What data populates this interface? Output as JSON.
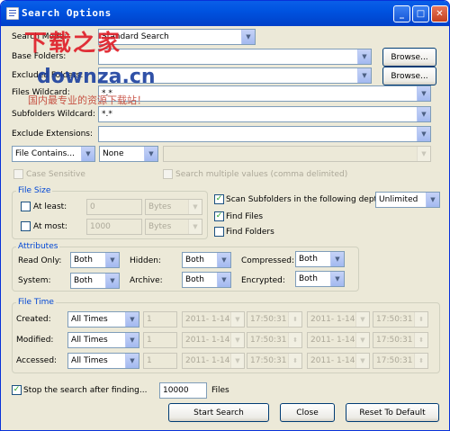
{
  "window": {
    "title": "Search Options",
    "buttons": [
      "_",
      "□",
      "✕"
    ]
  },
  "watermark": {
    "logo": "下载之家",
    "url": "downza.cn",
    "slogan": "国内最专业的资源下载站！"
  },
  "main": {
    "search_mode_label": "Search Mode:",
    "search_mode_value": "Standard Search",
    "base_folders_label": "Base Folders:",
    "base_folders_value": "",
    "browse1": "Browse...",
    "excluded_folders_label": "Excluded Folders:",
    "excluded_folders_value": "",
    "browse2": "Browse...",
    "files_wildcard_label": "Files Wildcard:",
    "files_wildcard_value": "*.*",
    "subfolders_wildcard_label": "Subfolders Wildcard:",
    "subfolders_wildcard_value": "*.*",
    "exclude_extensions_label": "Exclude Extensions:",
    "exclude_extensions_value": ""
  },
  "contains": {
    "mode": "File Contains...",
    "type": "None",
    "text": "",
    "case_sensitive": "Case Sensitive",
    "multiple_values": "Search multiple values (comma delimited)"
  },
  "file_size": {
    "title": "File Size",
    "at_least_label": "At least:",
    "at_least_value": "0",
    "at_least_unit": "Bytes",
    "at_most_label": "At most:",
    "at_most_value": "1000",
    "at_most_unit": "Bytes"
  },
  "scan": {
    "label": "Scan Subfolders in the following depth:",
    "depth": "Unlimited",
    "checked": true,
    "find_files_label": "Find Files",
    "find_files_checked": true,
    "find_folders_label": "Find Folders",
    "find_folders_checked": false
  },
  "attributes": {
    "title": "Attributes",
    "read_only_label": "Read Only:",
    "read_only_value": "Both",
    "hidden_label": "Hidden:",
    "hidden_value": "Both",
    "compressed_label": "Compressed:",
    "compressed_value": "Both",
    "system_label": "System:",
    "system_value": "Both",
    "archive_label": "Archive:",
    "archive_value": "Both",
    "encrypted_label": "Encrypted:",
    "encrypted_value": "Both"
  },
  "file_time": {
    "title": "File Time",
    "rows": [
      {
        "label": "Created:",
        "mode": "All Times",
        "num": "1",
        "date1": "2011- 1-14",
        "time1": "17:50:31",
        "date2": "2011- 1-14",
        "time2": "17:50:31"
      },
      {
        "label": "Modified:",
        "mode": "All Times",
        "num": "1",
        "date1": "2011- 1-14",
        "time1": "17:50:31",
        "date2": "2011- 1-14",
        "time2": "17:50:31"
      },
      {
        "label": "Accessed:",
        "mode": "All Times",
        "num": "1",
        "date1": "2011- 1-14",
        "time1": "17:50:31",
        "date2": "2011- 1-14",
        "time2": "17:50:31"
      }
    ]
  },
  "stop": {
    "label": "Stop the search after finding...",
    "checked": true,
    "count": "10000",
    "unit": "Files"
  },
  "footer": {
    "start": "Start Search",
    "close": "Close",
    "reset": "Reset To Default"
  },
  "colors": {
    "titlebar": "#0053e0",
    "group_title": "#0046d5",
    "dialog_bg": "#ece9d8",
    "watermark_red": "#e0202a",
    "watermark_blue": "#1a3f9e"
  }
}
